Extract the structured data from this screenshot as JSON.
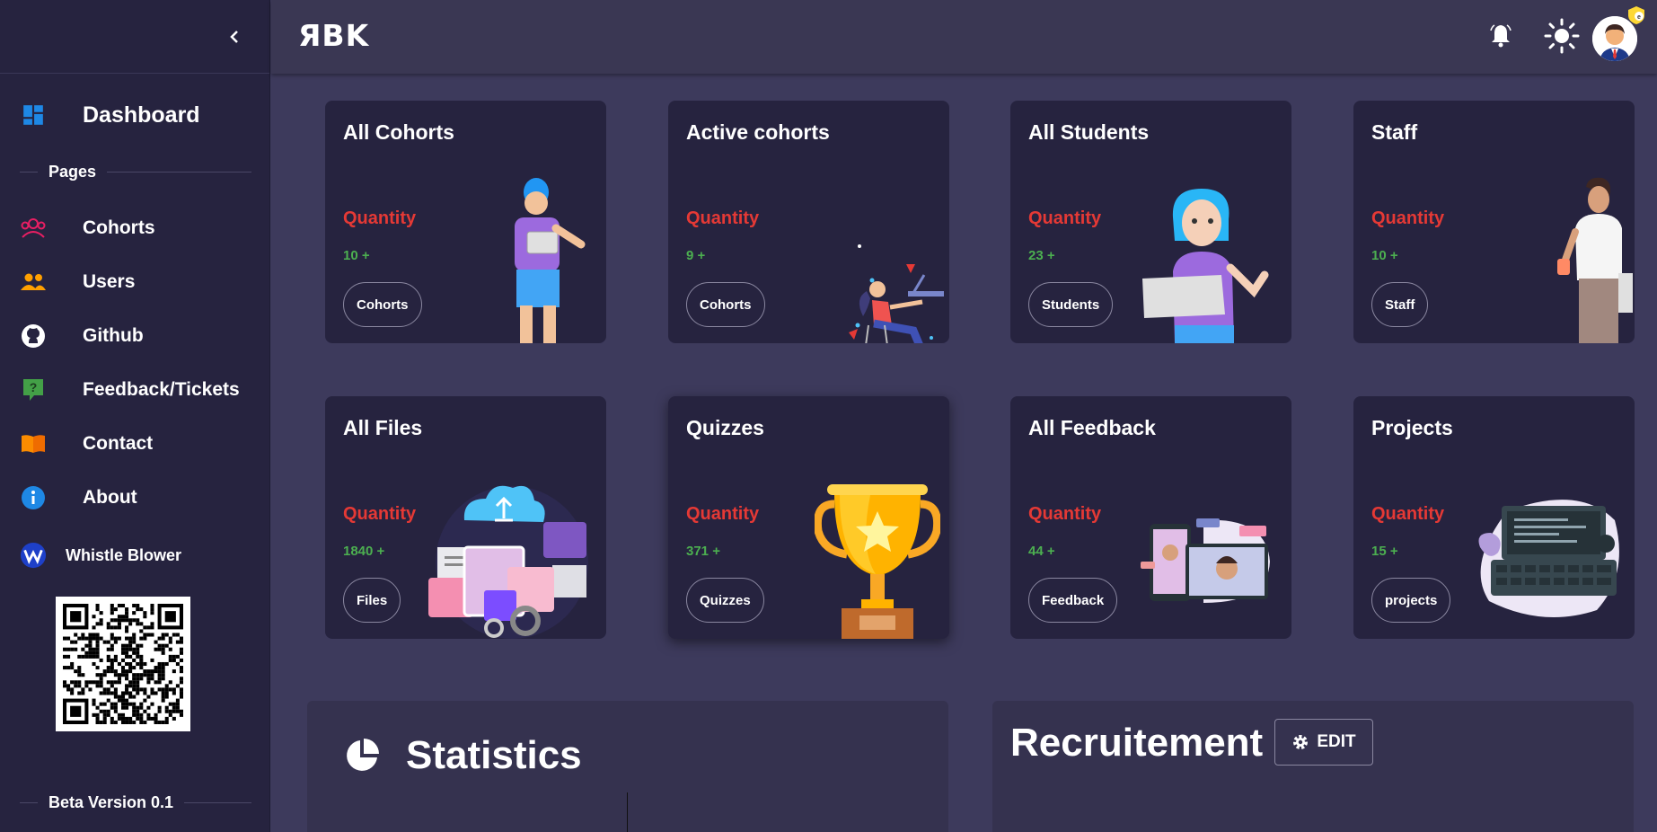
{
  "sidebar": {
    "nav_items": [
      {
        "label": "Dashboard",
        "icon": "dashboard-icon"
      },
      {
        "label": "Cohorts",
        "icon": "cohorts-icon"
      },
      {
        "label": "Users",
        "icon": "users-icon"
      },
      {
        "label": "Github",
        "icon": "github-icon"
      },
      {
        "label": "Feedback/Tickets",
        "icon": "feedback-icon"
      },
      {
        "label": "Contact",
        "icon": "contact-icon"
      },
      {
        "label": "About",
        "icon": "info-icon"
      },
      {
        "label": "Whistle Blower",
        "icon": "whistle-blower-icon"
      }
    ],
    "section_pages": "Pages",
    "version": "Beta Version 0.1"
  },
  "header": {
    "logo": "ЯBK"
  },
  "cards": [
    {
      "title": "All Cohorts",
      "qty_label": "Quantity",
      "value": "10 +",
      "button": "Cohorts"
    },
    {
      "title": "Active cohorts",
      "qty_label": "Quantity",
      "value": "9 +",
      "button": "Cohorts"
    },
    {
      "title": "All Students",
      "qty_label": "Quantity",
      "value": "23 +",
      "button": "Students"
    },
    {
      "title": "Staff",
      "qty_label": "Quantity",
      "value": "10 +",
      "button": "Staff"
    },
    {
      "title": "All Files",
      "qty_label": "Quantity",
      "value": "1840 +",
      "button": "Files"
    },
    {
      "title": "Quizzes",
      "qty_label": "Quantity",
      "value": "371 +",
      "button": "Quizzes"
    },
    {
      "title": "All Feedback",
      "qty_label": "Quantity",
      "value": "44 +",
      "button": "Feedback"
    },
    {
      "title": "Projects",
      "qty_label": "Quantity",
      "value": "15 +",
      "button": "projects"
    }
  ],
  "statistics": {
    "title": "Statistics"
  },
  "recruitement": {
    "title": "Recruitement",
    "edit_label": "EDIT"
  },
  "colors": {
    "sidebar_bg": "#26233f",
    "main_bg": "#3d3a5c",
    "quantity_red": "#e53935",
    "value_green": "#4caf50"
  }
}
